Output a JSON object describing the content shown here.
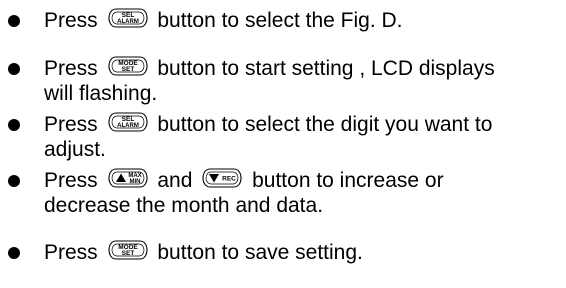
{
  "items": [
    {
      "pre": "Press",
      "button": {
        "icon": "sel-alarm-button-icon",
        "top": "SEL",
        "bottom": "ALARM"
      },
      "post": "button to select the Fig. D.",
      "line2": ""
    },
    {
      "pre": "Press",
      "button": {
        "icon": "mode-set-button-icon",
        "top": "MODE",
        "bottom": "SET"
      },
      "post": "button to start setting , LCD displays",
      "line2": "will flashing."
    },
    {
      "pre": "Press",
      "button": {
        "icon": "sel-alarm-button-icon",
        "top": "SEL",
        "bottom": "ALARM"
      },
      "post": "button to select the digit you want to",
      "line2": "adjust."
    },
    {
      "pre": "Press",
      "button": {
        "icon": "up-max-min-button-icon",
        "top": "MAX",
        "bottom": "MIN"
      },
      "mid": "and",
      "button2": {
        "icon": "down-rec-button-icon",
        "label": "REC"
      },
      "post": "button to increase or",
      "line2": "decrease the month and data."
    },
    {
      "pre": "Press",
      "button": {
        "icon": "mode-set-button-icon",
        "top": "MODE",
        "bottom": "SET"
      },
      "post": "button to save setting.",
      "line2": ""
    }
  ]
}
